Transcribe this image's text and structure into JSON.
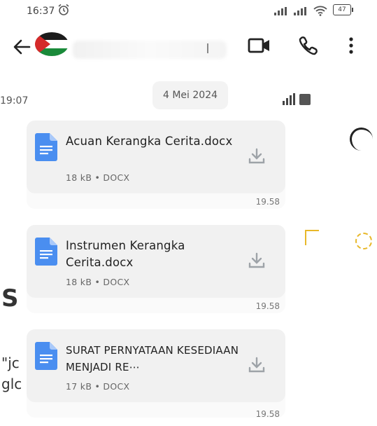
{
  "status_bar": {
    "time": "16:37",
    "battery": "47",
    "icons": [
      "alarm-icon",
      "signal-icon",
      "signal-icon",
      "wifi-icon",
      "battery-icon"
    ]
  },
  "header": {
    "icons": [
      "back-arrow-icon",
      "video-call-icon",
      "phone-call-icon",
      "more-options-icon"
    ]
  },
  "chat": {
    "date_chip": "4 Mei 2024",
    "messages": [
      {
        "file_name": "Acuan Kerangka Cerita.docx",
        "meta": "18 kB • DOCX",
        "time": "19.58"
      },
      {
        "file_name": "Instrumen Kerangka Cerita.docx",
        "meta": "18 kB • DOCX",
        "time": "19.58"
      },
      {
        "file_name": "SURAT PERNYATAAN KESEDIAAN MENJADI RE⋯",
        "meta": "17 kB • DOCX",
        "time": "19.58"
      }
    ]
  },
  "background_fragments": {
    "time": "19:07",
    "heading": "S",
    "line1": "\"jc",
    "line2": "glс"
  },
  "colors": {
    "doc_blue": "#4a8ef0",
    "accent_yellow": "#e8b829"
  }
}
